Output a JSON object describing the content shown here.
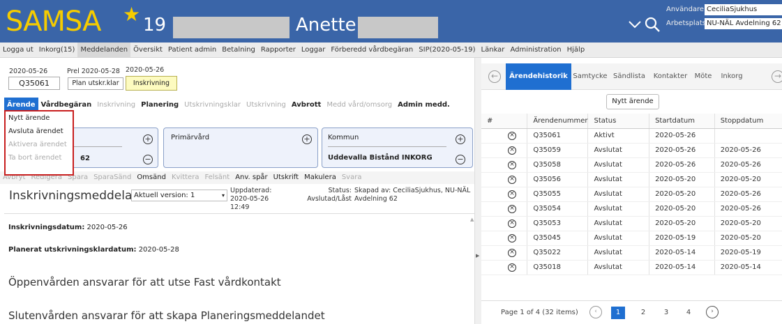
{
  "header": {
    "app_name": "SAMSA",
    "patient_count": "19",
    "patient_first_name": "Anette",
    "user_label": "Användare:",
    "user_value": "CeciliaSjukhus",
    "workplace_label": "Arbetsplats:",
    "workplace_value": "NU-NÄL Avdelning 62",
    "colors": {
      "bar": "#3a65a8",
      "logo": "#f5cc00"
    }
  },
  "menu": [
    "Logga ut",
    "Inkorg(15)",
    "Meddelanden",
    "Översikt",
    "Patient admin",
    "Betalning",
    "Rapporter",
    "Loggar",
    "Förberedd vårdbegäran",
    "SIP(2020-05-19)",
    "Länkar",
    "Administration",
    "Hjälp"
  ],
  "case": {
    "start_date": "2020-05-26",
    "case_number": "Q35061",
    "prel_label": "Prel 2020-05-28",
    "plan_label": "Plan utskr.klar",
    "inskr_date": "2020-05-26",
    "inskr_label": "Inskrivning"
  },
  "tabs": [
    {
      "label": "Ärende",
      "state": "active"
    },
    {
      "label": "Vårdbegäran",
      "state": "normal"
    },
    {
      "label": "Inskrivning",
      "state": "dim"
    },
    {
      "label": "Planering",
      "state": "normal"
    },
    {
      "label": "Utskrivningsklar",
      "state": "dim"
    },
    {
      "label": "Utskrivning",
      "state": "dim"
    },
    {
      "label": "Avbrott",
      "state": "normal"
    },
    {
      "label": "Medd vård/omsorg",
      "state": "dim"
    },
    {
      "label": "Admin medd.",
      "state": "normal"
    }
  ],
  "dropdown": [
    {
      "label": "Nytt ärende",
      "enabled": true
    },
    {
      "label": "Avsluta ärendet",
      "enabled": true
    },
    {
      "label": "Aktivera ärendet",
      "enabled": false
    },
    {
      "label": "Ta bort ärendet",
      "enabled": false
    }
  ],
  "cards": {
    "left_text": "62",
    "primarvard": "Primärvård",
    "kommun": "Kommun",
    "kommun_value": "Uddevalla Bistånd INKORG"
  },
  "actions": [
    {
      "label": "Avbryt",
      "enabled": false
    },
    {
      "label": "Redigera",
      "enabled": false
    },
    {
      "label": "Spara",
      "enabled": false
    },
    {
      "label": "SparaSänd",
      "enabled": false
    },
    {
      "label": "Omsänd",
      "enabled": true
    },
    {
      "label": "Kvittera",
      "enabled": false
    },
    {
      "label": "Felsänt",
      "enabled": false
    },
    {
      "label": "Anv. spår",
      "enabled": true
    },
    {
      "label": "Utskrift",
      "enabled": true
    },
    {
      "label": "Makulera",
      "enabled": true
    },
    {
      "label": "Svara",
      "enabled": false
    }
  ],
  "document": {
    "title": "Inskrivningsmeddelande",
    "version": "Aktuell version: 1",
    "updated": "Uppdaterad: 2020-05-26 12:49",
    "status": "Status: Avslutad/Låst",
    "created_by": "Skapad av: CeciliaSjukhus, NU-NÄL Avdelning 62",
    "inskr_label": "Inskrivningsdatum:",
    "inskr_value": "2020-05-26",
    "planned_label": "Planerat utskrivningsklardatum:",
    "planned_value": "2020-05-28",
    "line1": "Öppenvården ansvarar för att utse Fast vårdkontakt",
    "line2": "Slutenvården ansvarar för att skapa Planeringsmeddelandet"
  },
  "right": {
    "tabs": [
      "Ärendehistorik",
      "Samtycke",
      "Sändlista",
      "Kontakter",
      "Möte",
      "Inkorg"
    ],
    "new_case": "Nytt ärende",
    "columns": [
      "#",
      "Ärendenummer",
      "Status",
      "Startdatum",
      "Stoppdatum"
    ],
    "rows": [
      {
        "num": "Q35061",
        "status": "Aktivt",
        "start": "2020-05-26",
        "stop": ""
      },
      {
        "num": "Q35059",
        "status": "Avslutat",
        "start": "2020-05-26",
        "stop": "2020-05-26"
      },
      {
        "num": "Q35058",
        "status": "Avslutat",
        "start": "2020-05-26",
        "stop": "2020-05-26"
      },
      {
        "num": "Q35056",
        "status": "Avslutat",
        "start": "2020-05-20",
        "stop": "2020-05-20"
      },
      {
        "num": "Q35055",
        "status": "Avslutat",
        "start": "2020-05-20",
        "stop": "2020-05-26"
      },
      {
        "num": "Q35054",
        "status": "Avslutat",
        "start": "2020-05-20",
        "stop": "2020-05-26"
      },
      {
        "num": "Q35053",
        "status": "Avslutat",
        "start": "2020-05-20",
        "stop": "2020-05-20"
      },
      {
        "num": "Q35045",
        "status": "Avslutat",
        "start": "2020-05-19",
        "stop": "2020-05-20"
      },
      {
        "num": "Q35022",
        "status": "Avslutat",
        "start": "2020-05-14",
        "stop": "2020-05-19"
      },
      {
        "num": "Q35018",
        "status": "Avslutat",
        "start": "2020-05-14",
        "stop": "2020-05-14"
      }
    ],
    "pager_text": "Page 1 of 4 (32 items)",
    "pages": [
      "1",
      "2",
      "3",
      "4"
    ]
  }
}
